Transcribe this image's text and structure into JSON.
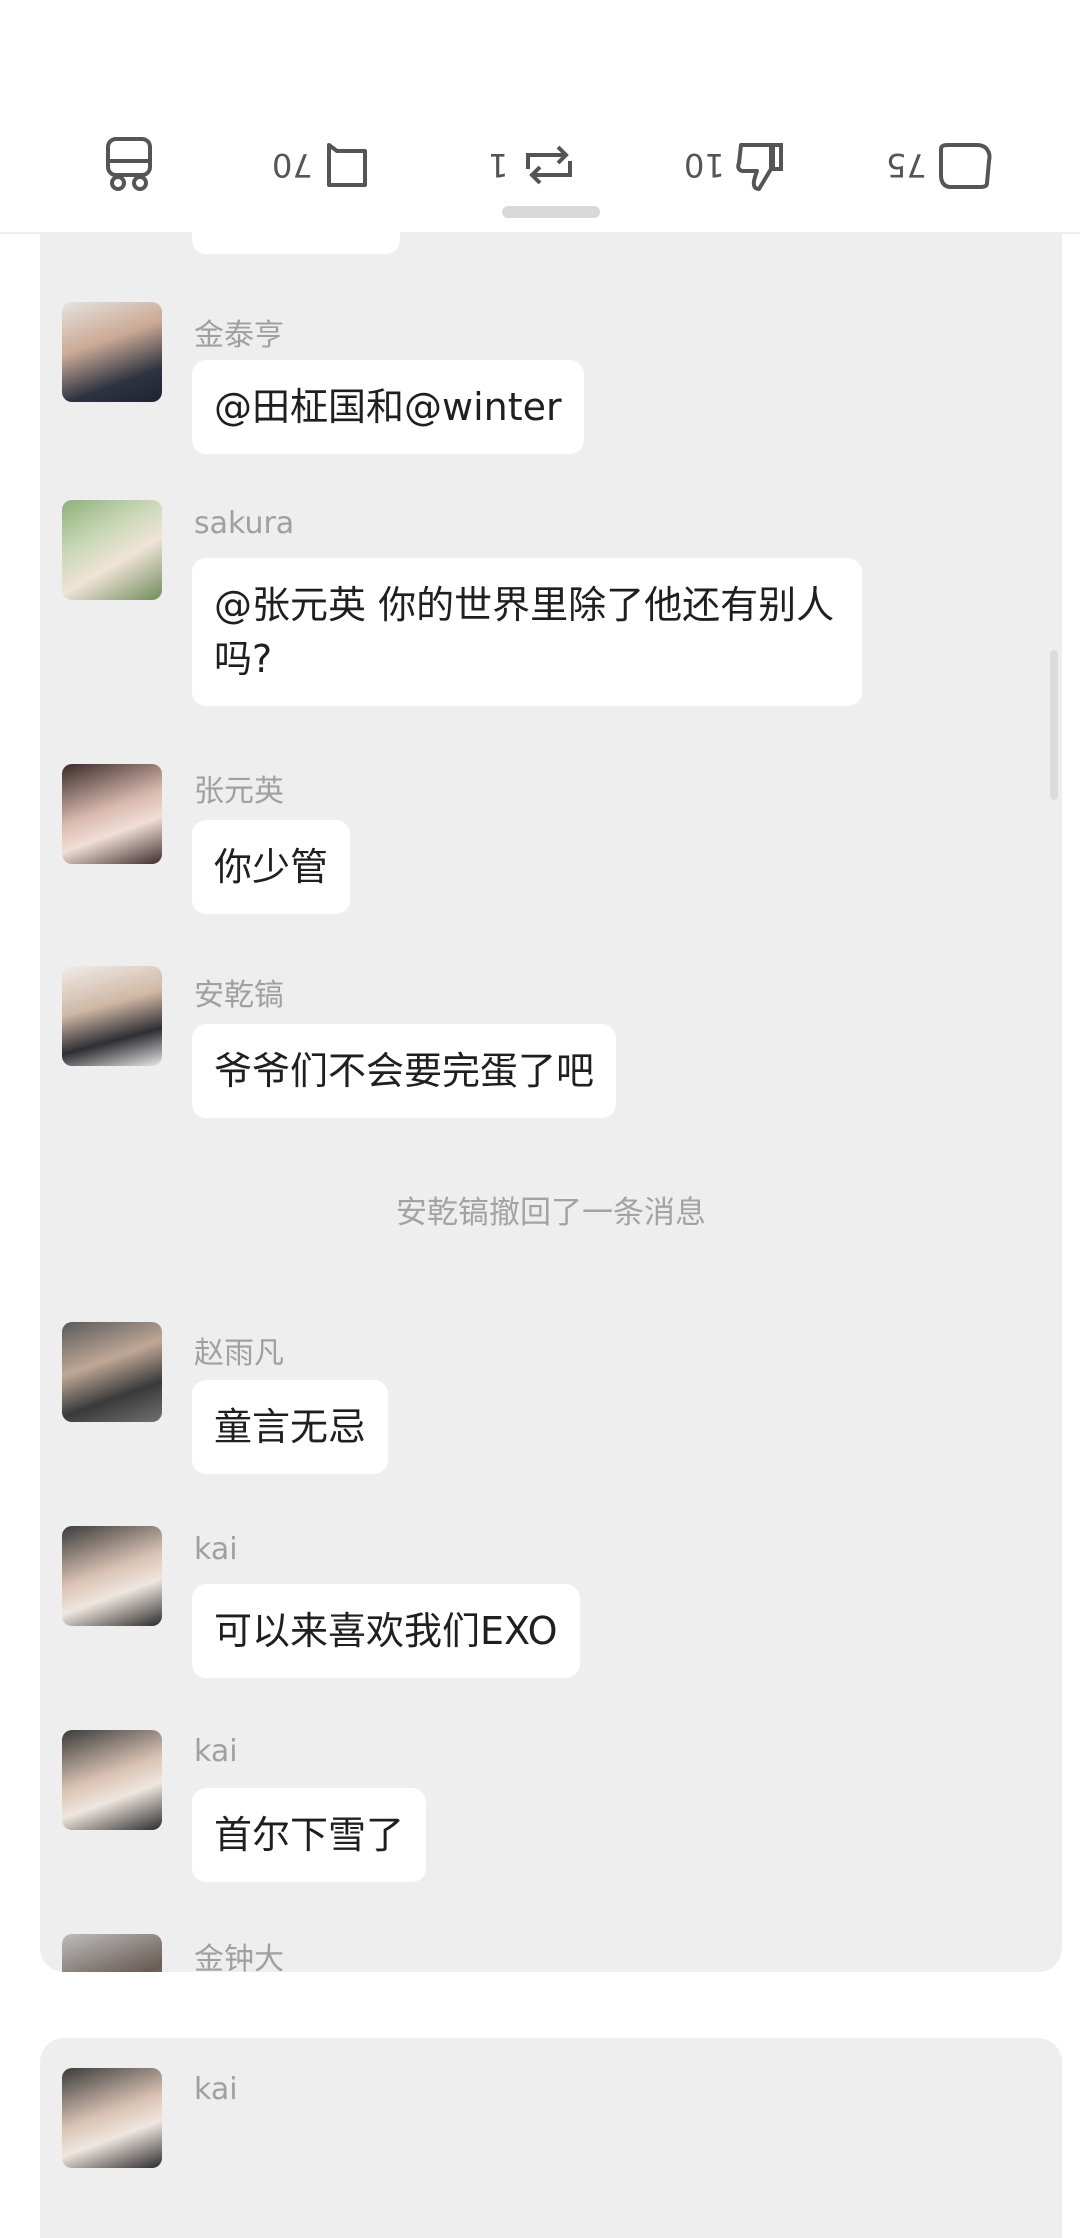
{
  "actions": {
    "like_count": "75",
    "dislike_count": "10",
    "repost_count": "1",
    "comment_count": "70"
  },
  "messages": [
    {
      "name": "金泰亨",
      "text": "@田柾国和@winter"
    },
    {
      "name": "sakura",
      "text": "@张元英 你的世界里除了他还有别人吗?"
    },
    {
      "name": "张元英",
      "text": "你少管"
    },
    {
      "name": "安乾镐",
      "text": "爷爷们不会要完蛋了吧"
    },
    {
      "system": "安乾镐撤回了一条消息"
    },
    {
      "name": "赵雨凡",
      "text": "童言无忌"
    },
    {
      "name": "kai",
      "text": "可以来喜欢我们EXO"
    },
    {
      "name": "kai",
      "text": "首尔下雪了"
    },
    {
      "name": "金钟大"
    }
  ],
  "panel2": {
    "name": "kai"
  },
  "colors": {
    "panel_bg": "#eeeeee",
    "bubble_bg": "#ffffff",
    "name_text": "#a0a0a0"
  }
}
